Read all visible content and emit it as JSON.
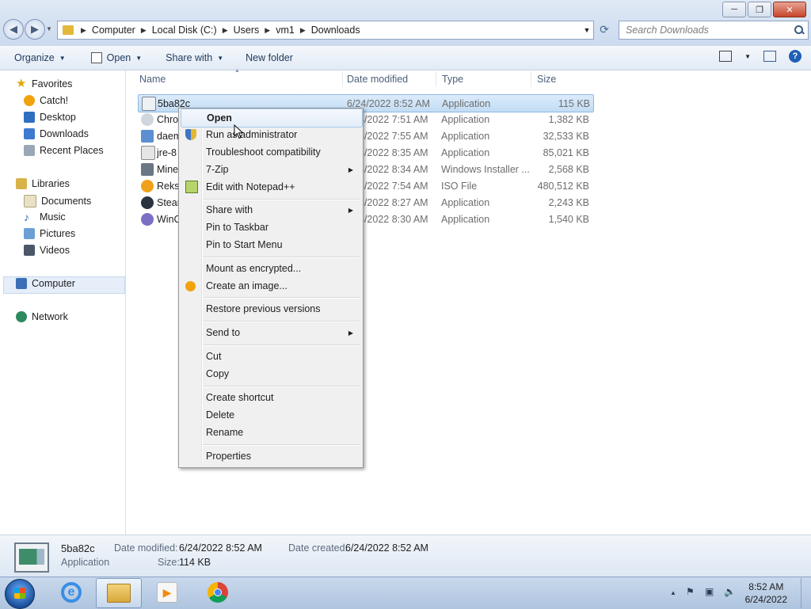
{
  "window": {
    "minimize": "─",
    "maximize": "❐",
    "close": "✕"
  },
  "address": {
    "crumbs": [
      "Computer",
      "Local Disk (C:)",
      "Users",
      "vm1",
      "Downloads"
    ],
    "search_placeholder": "Search Downloads"
  },
  "toolbar": {
    "organize": "Organize",
    "open": "Open",
    "share_with": "Share with",
    "new_folder": "New folder"
  },
  "nav": {
    "favorites": "Favorites",
    "fav_items": [
      "Catch!",
      "Desktop",
      "Downloads",
      "Recent Places"
    ],
    "libraries": "Libraries",
    "lib_items": [
      "Documents",
      "Music",
      "Pictures",
      "Videos"
    ],
    "computer": "Computer",
    "network": "Network"
  },
  "columns": {
    "name": "Name",
    "date": "Date modified",
    "type": "Type",
    "size": "Size"
  },
  "files": [
    {
      "name": "5ba82c",
      "date": "6/24/2022 8:52 AM",
      "type": "Application",
      "size": "115 KB"
    },
    {
      "name": "Chro",
      "date": "4/2022 7:51 AM",
      "type": "Application",
      "size": "1,382 KB"
    },
    {
      "name": "daem",
      "date": "4/2022 7:55 AM",
      "type": "Application",
      "size": "32,533 KB"
    },
    {
      "name": "jre-8",
      "date": "4/2022 8:35 AM",
      "type": "Application",
      "size": "85,021 KB"
    },
    {
      "name": "Mine",
      "date": "4/2022 8:34 AM",
      "type": "Windows Installer ...",
      "size": "2,568 KB"
    },
    {
      "name": "Reksi",
      "date": "4/2022 7:54 AM",
      "type": "ISO File",
      "size": "480,512 KB"
    },
    {
      "name": "Stear",
      "date": "4/2022 8:27 AM",
      "type": "Application",
      "size": "2,243 KB"
    },
    {
      "name": "WinC",
      "date": "4/2022 8:30 AM",
      "type": "Application",
      "size": "1,540 KB"
    }
  ],
  "menu": {
    "open": "Open",
    "run_admin": "Run as administrator",
    "troubleshoot": "Troubleshoot compatibility",
    "seven_zip": "7-Zip",
    "notepadpp": "Edit with Notepad++",
    "share_with": "Share with",
    "pin_taskbar": "Pin to Taskbar",
    "pin_start": "Pin to Start Menu",
    "mount": "Mount as encrypted...",
    "create_image": "Create an image...",
    "restore": "Restore previous versions",
    "send_to": "Send to",
    "cut": "Cut",
    "copy": "Copy",
    "create_shortcut": "Create shortcut",
    "delete": "Delete",
    "rename": "Rename",
    "properties": "Properties"
  },
  "details": {
    "name": "5ba82c",
    "type": "Application",
    "modified_label": "Date modified:",
    "modified": "6/24/2022 8:52 AM",
    "created_label": "Date created:",
    "created": "6/24/2022 8:52 AM",
    "size_label": "Size:",
    "size": "114 KB"
  },
  "clock": {
    "time": "8:52 AM",
    "date": "6/24/2022"
  },
  "colors": {
    "accent": "#1f5fb6",
    "selection": "#c2dcf3"
  }
}
